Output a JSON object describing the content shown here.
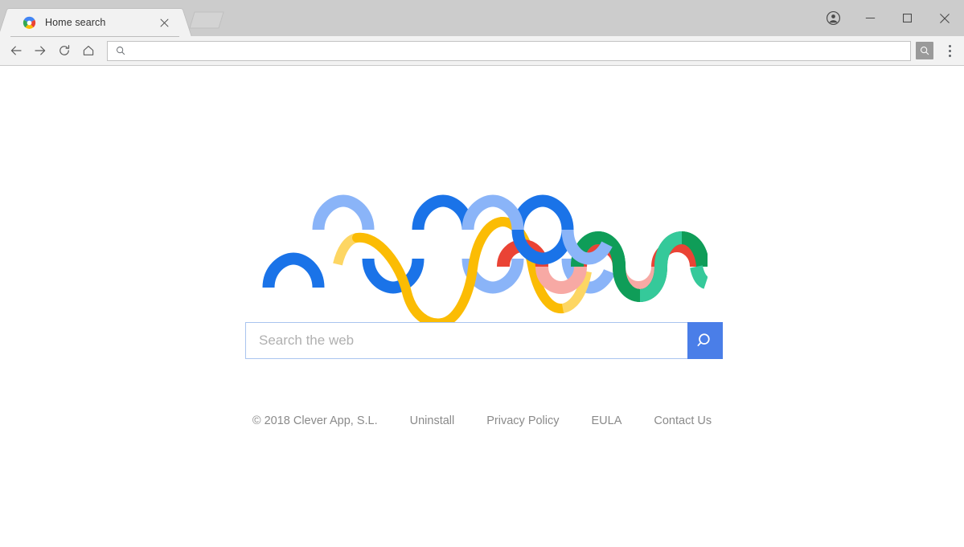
{
  "window": {
    "profile_icon": "account-circle-icon",
    "minimize_label": "Minimize",
    "maximize_label": "Maximize",
    "close_label": "Close"
  },
  "tabs": [
    {
      "title": "Home search",
      "favicon": "pinwheel-logo-icon",
      "close_label": "Close tab",
      "active": true
    }
  ],
  "newtab": {
    "label": "New tab"
  },
  "toolbar": {
    "back_label": "Back",
    "forward_label": "Forward",
    "reload_label": "Reload",
    "home_label": "Home",
    "omnibox": {
      "value": "",
      "placeholder": "",
      "icon": "search-icon"
    },
    "search_button_label": "Search",
    "menu_label": "Customize and control"
  },
  "page": {
    "logo": {
      "name": "colored-sound-waves-logo",
      "colors": {
        "blue_dark": "#1a73e8",
        "blue_light": "#8ab4f8",
        "yellow_dark": "#fbbc04",
        "yellow_light": "#fdd663",
        "red_dark": "#ea4335",
        "red_light": "#f7a9a4",
        "green_dark": "#0f9d58",
        "green_light": "#35c99a"
      }
    },
    "search": {
      "value": "",
      "placeholder": "Search the web",
      "button_icon": "search-icon",
      "button_label": "Search",
      "accent_color": "#4a7ee8",
      "border_color": "#a9c4ef"
    },
    "footer": {
      "copyright": "© 2018 Clever App, S.L.",
      "links": [
        {
          "label": "Uninstall"
        },
        {
          "label": "Privacy Policy"
        },
        {
          "label": "EULA"
        },
        {
          "label": "Contact Us"
        }
      ]
    }
  }
}
